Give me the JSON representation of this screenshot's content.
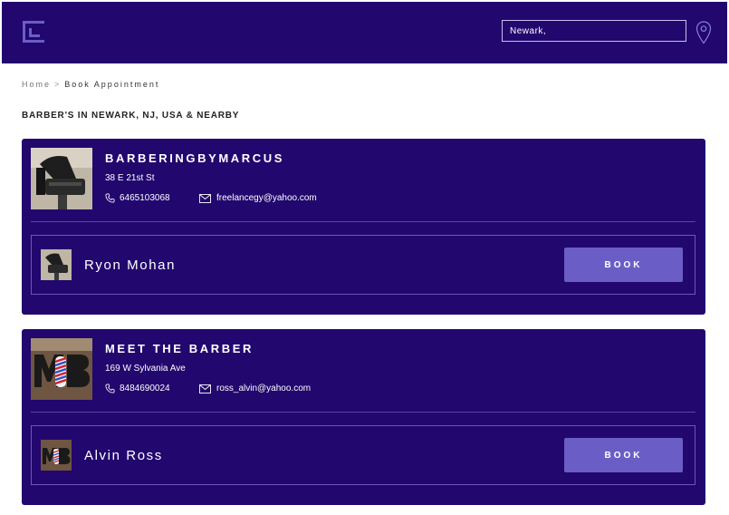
{
  "header": {
    "logo_icon": "brand-logo-icon",
    "search": {
      "value": "Newark,"
    },
    "location_icon": "map-pin-icon"
  },
  "breadcrumb": {
    "home": "Home",
    "separator": ">",
    "current": "Book Appointment"
  },
  "page_title": "BARBER'S IN NEWARK, NJ, USA & NEARBY",
  "shops": [
    {
      "name": "BARBERINGBYMARCUS",
      "address": "38 E 21st St",
      "phone": "6465103068",
      "email": "freelancegy@yahoo.com",
      "barber": {
        "name": "Ryon Mohan",
        "book_label": "BOOK"
      }
    },
    {
      "name": "MEET THE BARBER",
      "address": "169 W Sylvania Ave",
      "phone": "8484690024",
      "email": "ross_alvin@yahoo.com",
      "barber": {
        "name": "Alvin Ross",
        "book_label": "BOOK"
      }
    }
  ],
  "colors": {
    "header_bg": "#22076e",
    "card_bg": "#22076e",
    "button_bg": "#6a5ec6",
    "logo_accent": "#6a5ec6"
  }
}
